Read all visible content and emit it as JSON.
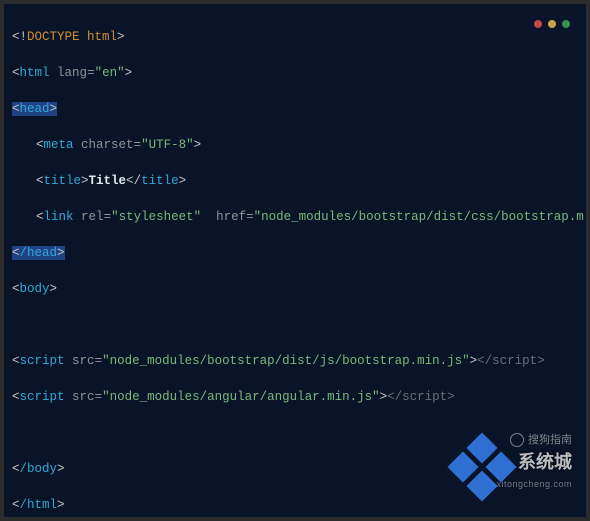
{
  "code": {
    "doctype": "DOCTYPE html",
    "htmlTag": "html",
    "htmlLangAttr": "lang",
    "htmlLangVal": "\"en\"",
    "headOpen": "head",
    "headClose": "/head",
    "metaTag": "meta",
    "metaAttr": "charset",
    "metaVal": "\"UTF-8\"",
    "titleTag": "title",
    "titleText": "Title",
    "linkTag": "link",
    "linkRelAttr": "rel",
    "linkRelVal": "\"stylesheet\"",
    "linkHrefAttr": "href",
    "linkHrefVal": "\"node_modules/bootstrap/dist/css/bootstrap.min.css\"",
    "bodyTag": "body",
    "scriptTag": "script",
    "scriptSrcAttr": "src",
    "script1Val": "\"node_modules/bootstrap/dist/js/bootstrap.min.js\"",
    "script2Val": "\"node_modules/angular/angular.min.js\"",
    "scriptClose": "/script",
    "bodyClose": "/body",
    "htmlClose": "/html"
  },
  "watermark": {
    "sogou": "搜狗指南",
    "brand": "系统城",
    "url": "xitongcheng.com"
  }
}
